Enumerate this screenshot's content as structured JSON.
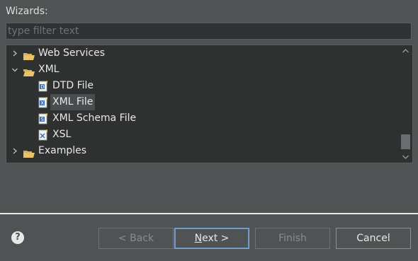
{
  "label": "Wizards:",
  "filter": {
    "placeholder": "type filter text",
    "value": ""
  },
  "tree": [
    {
      "label": "Web Services",
      "expanded": false
    },
    {
      "label": "XML",
      "expanded": true
    },
    {
      "label": "DTD File",
      "icon": "dtd-file-icon"
    },
    {
      "label": "XML File",
      "icon": "xml-file-icon",
      "selected": true
    },
    {
      "label": "XML Schema File",
      "icon": "xml-schema-file-icon"
    },
    {
      "label": "XSL",
      "icon": "xsl-file-icon"
    },
    {
      "label": "Examples",
      "expanded": false
    }
  ],
  "buttons": {
    "back": "< Back",
    "next_mnemonic": "N",
    "next_rest": "ext >",
    "finish": "Finish",
    "cancel": "Cancel"
  },
  "help": "?",
  "colors": {
    "background": "#505354",
    "tree_background": "#2f3131",
    "accent": "#7aa7d8"
  }
}
